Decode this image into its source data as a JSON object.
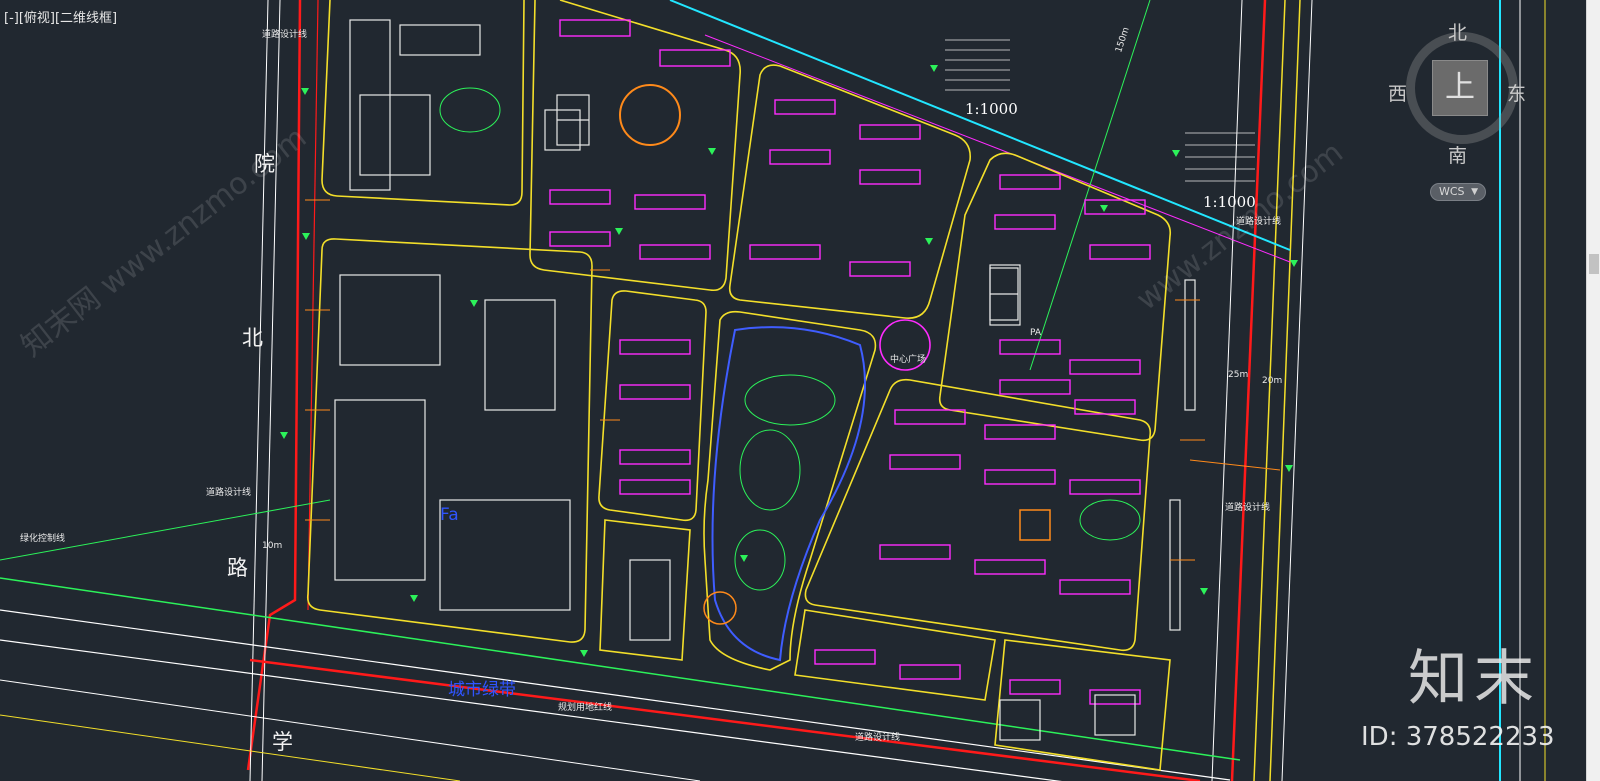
{
  "app": {
    "viewport_label": "[-][俯视][二维线框]"
  },
  "drawing": {
    "scale_1": "1:1000",
    "scale_2": "1:1000",
    "road_name_chars": [
      "院",
      "北",
      "路",
      "学"
    ],
    "dim_top": "150m",
    "dim_right_a": "25m",
    "dim_right_b": "20m",
    "dim_left": "10m",
    "lot_tag": "Fa",
    "green_belt_label": "城市绿带",
    "labels_white": [
      "道路设计线",
      "道路设计线",
      "绿化控制线",
      "道路设计线",
      "道路设计线",
      "规划用地红线",
      "道路设计线",
      "中心广场",
      "PA"
    ]
  },
  "viewcube": {
    "north": "北",
    "south": "南",
    "east": "东",
    "west": "西",
    "face": "上",
    "wcs_label": "WCS"
  },
  "watermark": {
    "logo": "知末",
    "id_text": "ID: 378522233",
    "site": "www.znzmo.com",
    "site_cn": "知末网"
  },
  "colors": {
    "background": "#212830",
    "red_line": "#ff1a1a",
    "yellow_line": "#f3df2a",
    "magenta": "#ff2cff",
    "cyan": "#22e6ff",
    "green": "#2cf25a",
    "blue": "#3f5dff",
    "orange": "#ff8a1a"
  }
}
